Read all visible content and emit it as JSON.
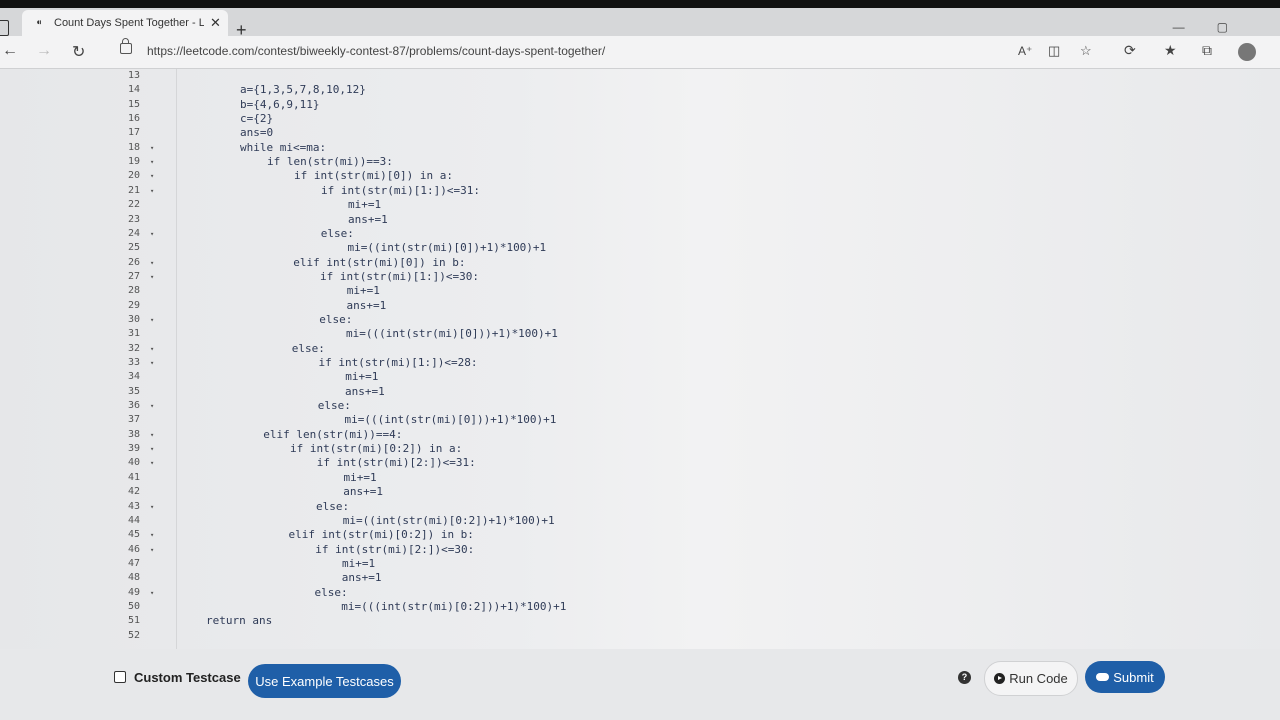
{
  "browser": {
    "tab_title": "Count Days Spent Together - Lee",
    "url": "https://leetcode.com/contest/biweekly-contest-87/problems/count-days-spent-together/"
  },
  "editor": {
    "lines": [
      {
        "n": "13",
        "fold": false,
        "indent": 0,
        "text": ""
      },
      {
        "n": "14",
        "fold": false,
        "indent": 2,
        "text": "a={1,3,5,7,8,10,12}"
      },
      {
        "n": "15",
        "fold": false,
        "indent": 2,
        "text": "b={4,6,9,11}"
      },
      {
        "n": "16",
        "fold": false,
        "indent": 2,
        "text": "c={2}"
      },
      {
        "n": "17",
        "fold": false,
        "indent": 2,
        "text": "ans=0"
      },
      {
        "n": "18",
        "fold": true,
        "indent": 2,
        "text": "while mi<=ma:"
      },
      {
        "n": "19",
        "fold": true,
        "indent": 3,
        "text": "if len(str(mi))==3:"
      },
      {
        "n": "20",
        "fold": true,
        "indent": 4,
        "text": "if int(str(mi)[0]) in a:"
      },
      {
        "n": "21",
        "fold": true,
        "indent": 5,
        "text": "if int(str(mi)[1:])<=31:"
      },
      {
        "n": "22",
        "fold": false,
        "indent": 6,
        "text": "mi+=1"
      },
      {
        "n": "23",
        "fold": false,
        "indent": 6,
        "text": "ans+=1"
      },
      {
        "n": "24",
        "fold": true,
        "indent": 5,
        "text": "else:"
      },
      {
        "n": "25",
        "fold": false,
        "indent": 6,
        "text": "mi=((int(str(mi)[0])+1)*100)+1"
      },
      {
        "n": "26",
        "fold": true,
        "indent": 4,
        "text": "elif int(str(mi)[0]) in b:"
      },
      {
        "n": "27",
        "fold": true,
        "indent": 5,
        "text": "if int(str(mi)[1:])<=30:"
      },
      {
        "n": "28",
        "fold": false,
        "indent": 6,
        "text": "mi+=1"
      },
      {
        "n": "29",
        "fold": false,
        "indent": 6,
        "text": "ans+=1"
      },
      {
        "n": "30",
        "fold": true,
        "indent": 5,
        "text": "else:"
      },
      {
        "n": "31",
        "fold": false,
        "indent": 6,
        "text": "mi=(((int(str(mi)[0]))+1)*100)+1"
      },
      {
        "n": "32",
        "fold": true,
        "indent": 4,
        "text": "else:"
      },
      {
        "n": "33",
        "fold": true,
        "indent": 5,
        "text": "if int(str(mi)[1:])<=28:"
      },
      {
        "n": "34",
        "fold": false,
        "indent": 6,
        "text": "mi+=1"
      },
      {
        "n": "35",
        "fold": false,
        "indent": 6,
        "text": "ans+=1"
      },
      {
        "n": "36",
        "fold": true,
        "indent": 5,
        "text": "else:"
      },
      {
        "n": "37",
        "fold": false,
        "indent": 6,
        "text": "mi=(((int(str(mi)[0]))+1)*100)+1"
      },
      {
        "n": "38",
        "fold": true,
        "indent": 3,
        "text": "elif len(str(mi))==4:"
      },
      {
        "n": "39",
        "fold": true,
        "indent": 4,
        "text": "if int(str(mi)[0:2]) in a:"
      },
      {
        "n": "40",
        "fold": true,
        "indent": 5,
        "text": "if int(str(mi)[2:])<=31:"
      },
      {
        "n": "41",
        "fold": false,
        "indent": 6,
        "text": "mi+=1"
      },
      {
        "n": "42",
        "fold": false,
        "indent": 6,
        "text": "ans+=1"
      },
      {
        "n": "43",
        "fold": true,
        "indent": 5,
        "text": "else:"
      },
      {
        "n": "44",
        "fold": false,
        "indent": 6,
        "text": "mi=((int(str(mi)[0:2])+1)*100)+1"
      },
      {
        "n": "45",
        "fold": true,
        "indent": 4,
        "text": "elif int(str(mi)[0:2]) in b:"
      },
      {
        "n": "46",
        "fold": true,
        "indent": 5,
        "text": "if int(str(mi)[2:])<=30:"
      },
      {
        "n": "47",
        "fold": false,
        "indent": 6,
        "text": "mi+=1"
      },
      {
        "n": "48",
        "fold": false,
        "indent": 6,
        "text": "ans+=1"
      },
      {
        "n": "49",
        "fold": true,
        "indent": 5,
        "text": "else:"
      },
      {
        "n": "50",
        "fold": false,
        "indent": 6,
        "text": "mi=(((int(str(mi)[0:2]))+1)*100)+1"
      },
      {
        "n": "51",
        "fold": false,
        "indent": 1,
        "text": "return ans"
      },
      {
        "n": "52",
        "fold": false,
        "indent": 0,
        "text": ""
      }
    ]
  },
  "footer": {
    "custom_testcase_label": "Custom Testcase",
    "example_button": "Use Example Testcases",
    "run_button": "Run Code",
    "submit_button": "Submit",
    "help_glyph": "?"
  },
  "icons": [
    "leetcode-tab-icon",
    "close-icon",
    "plus-icon",
    "back-icon",
    "forward-icon",
    "reload-icon",
    "lock-icon",
    "read-aloud-icon",
    "immersive-reader-icon",
    "favorite-add-icon",
    "extensions-icon",
    "favorites-icon",
    "collections-icon",
    "profile-icon",
    "help-icon",
    "play-icon",
    "cloud-upload-icon"
  ]
}
